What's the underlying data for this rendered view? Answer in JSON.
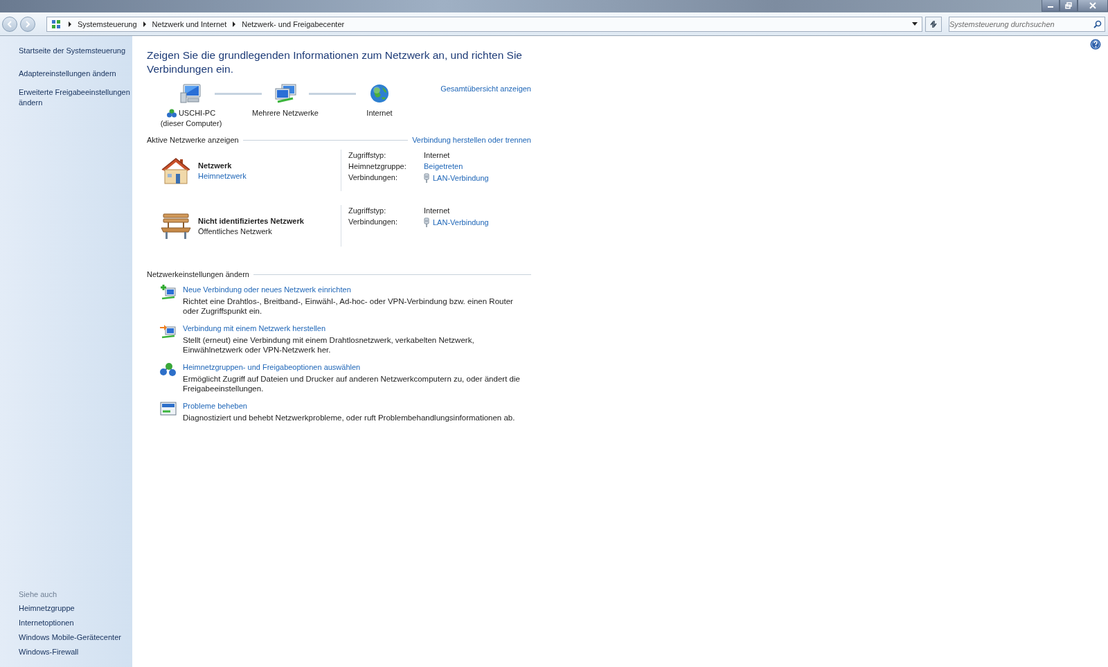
{
  "address_bar": {
    "breadcrumbs": [
      "Systemsteuerung",
      "Netzwerk und Internet",
      "Netzwerk- und Freigabecenter"
    ],
    "search_placeholder": "Systemsteuerung durchsuchen"
  },
  "sidebar": {
    "items": [
      "Startseite der Systemsteuerung",
      "Adaptereinstellungen ändern",
      "Erweiterte Freigabeeinstellungen ändern"
    ],
    "see_also_title": "Siehe auch",
    "see_also": [
      "Heimnetzgruppe",
      "Internetoptionen",
      "Windows Mobile-Gerätecenter",
      "Windows-Firewall"
    ]
  },
  "heading": "Zeigen Sie die grundlegenden Informationen zum Netzwerk an, und richten Sie Verbindungen ein.",
  "network_map": {
    "nodes": [
      {
        "kind": "computer",
        "label": "USCHI-PC",
        "sublabel": "(dieser Computer)"
      },
      {
        "kind": "networks",
        "label": "Mehrere Netzwerke"
      },
      {
        "kind": "internet",
        "label": "Internet"
      }
    ],
    "link": "Gesamtübersicht anzeigen"
  },
  "active_networks": {
    "title": "Aktive Netzwerke anzeigen",
    "link": "Verbindung herstellen oder trennen",
    "networks": [
      {
        "kind": "home",
        "name": "Netzwerk",
        "type": "Heimnetzwerk",
        "type_is_link": true,
        "props": [
          {
            "label": "Zugriffstyp:",
            "value": "Internet",
            "kind": "text"
          },
          {
            "label": "Heimnetzgruppe:",
            "value": "Beigetreten",
            "kind": "link"
          },
          {
            "label": "Verbindungen:",
            "value": "LAN-Verbindung",
            "kind": "connection"
          }
        ]
      },
      {
        "kind": "public",
        "name": "Nicht identifiziertes Netzwerk",
        "type": "Öffentliches Netzwerk",
        "type_is_link": false,
        "props": [
          {
            "label": "Zugriffstyp:",
            "value": "Internet",
            "kind": "text"
          },
          {
            "label": "Verbindungen:",
            "value": "LAN-Verbindung",
            "kind": "connection"
          }
        ]
      }
    ]
  },
  "settings": {
    "title": "Netzwerkeinstellungen ändern",
    "tasks": [
      {
        "kind": "new",
        "title": "Neue Verbindung oder neues Netzwerk einrichten",
        "description": "Richtet eine Drahtlos-, Breitband-, Einwähl-, Ad-hoc- oder VPN-Verbindung bzw. einen Router oder Zugriffspunkt ein."
      },
      {
        "kind": "connect",
        "title": "Verbindung mit einem Netzwerk herstellen",
        "description": "Stellt (erneut) eine Verbindung mit einem Drahtlosnetzwerk, verkabelten Netzwerk, Einwählnetzwerk oder VPN-Netzwerk her."
      },
      {
        "kind": "homegroup",
        "title": "Heimnetzgruppen- und Freigabeoptionen auswählen",
        "description": "Ermöglicht Zugriff auf Dateien und Drucker auf anderen Netzwerkcomputern zu, oder ändert die Freigabeeinstellungen."
      },
      {
        "kind": "troubleshoot",
        "title": "Probleme beheben",
        "description": "Diagnostiziert und behebt Netzwerkprobleme, oder ruft Problembehandlungsinformationen ab."
      }
    ]
  }
}
